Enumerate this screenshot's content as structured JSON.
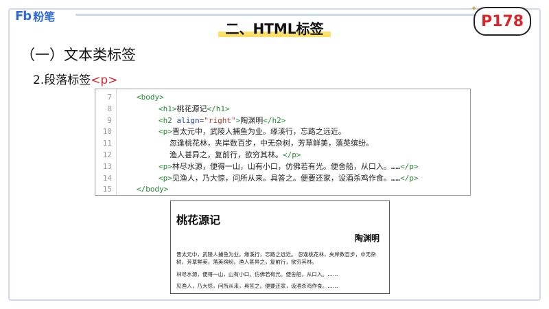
{
  "brand": {
    "mark": "Fb",
    "name": "粉笔"
  },
  "slide": {
    "title": "二、HTML标签",
    "page_badge": "P178",
    "section_heading": "（一）文本类标签",
    "sub_heading_prefix": "2.段落标签",
    "sub_heading_tag": "<p>"
  },
  "code": {
    "line_numbers": [
      "7",
      "8",
      "9",
      "10",
      "11",
      "12",
      "13",
      "14",
      "15"
    ],
    "lines": [
      {
        "parts": [
          {
            "cls": "tag-c",
            "t": "<body>"
          }
        ]
      },
      {
        "parts": [
          {
            "cls": "tag-c",
            "t": "<h1>"
          },
          {
            "cls": "",
            "t": "桃花源记"
          },
          {
            "cls": "tag-c",
            "t": "</h1>"
          }
        ]
      },
      {
        "parts": [
          {
            "cls": "tag-c",
            "t": "<h2 "
          },
          {
            "cls": "attr-c",
            "t": "align"
          },
          {
            "cls": "",
            "t": "="
          },
          {
            "cls": "str-c",
            "t": "\"right\""
          },
          {
            "cls": "tag-c",
            "t": ">"
          },
          {
            "cls": "",
            "t": "陶渊明"
          },
          {
            "cls": "tag-c",
            "t": "</h2>"
          }
        ]
      },
      {
        "parts": [
          {
            "cls": "tag-c",
            "t": "<p>"
          },
          {
            "cls": "",
            "t": "晋太元中，武陵人捕鱼为业。缘溪行，忘路之远近。"
          }
        ]
      },
      {
        "parts": [
          {
            "cls": "",
            "t": "忽逢桃花林，夹岸数百步，中无杂树，芳草鲜美，落英缤纷。"
          }
        ]
      },
      {
        "parts": [
          {
            "cls": "",
            "t": "渔人甚异之，复前行，欲穷其林。"
          },
          {
            "cls": "tag-c",
            "t": "</p>"
          }
        ]
      },
      {
        "parts": [
          {
            "cls": "tag-c",
            "t": "<p>"
          },
          {
            "cls": "",
            "t": "林尽水源，便得一山，山有小口，仿佛若有光。便舍船，从口入。……"
          },
          {
            "cls": "tag-c",
            "t": "</p>"
          }
        ]
      },
      {
        "parts": [
          {
            "cls": "tag-c",
            "t": "<p>"
          },
          {
            "cls": "",
            "t": "见渔人，乃大惊，问所从来。具答之。便要还家，设酒杀鸡作食。……"
          },
          {
            "cls": "tag-c",
            "t": "</p>"
          }
        ]
      },
      {
        "parts": [
          {
            "cls": "tag-c",
            "t": "</body>"
          }
        ]
      }
    ]
  },
  "preview": {
    "h1": "桃花源记",
    "h2": "陶渊明",
    "p1_line1": "晋太元中，武陵人捕鱼为业。缘溪行，忘路之远近。 忽逢桃花林，夹岸数百步，中无杂",
    "p1_line2": "树，芳草鲜美，落英缤纷。渔人甚异之，复前行，欲穷其林。",
    "p2": "林尽水源，便得一山，山有小口，仿佛若有光。便舍船，从口入。……",
    "p3": "见渔人，乃大惊，问所从来，具答之。便要还家，设酒杀鸡作食。……"
  }
}
